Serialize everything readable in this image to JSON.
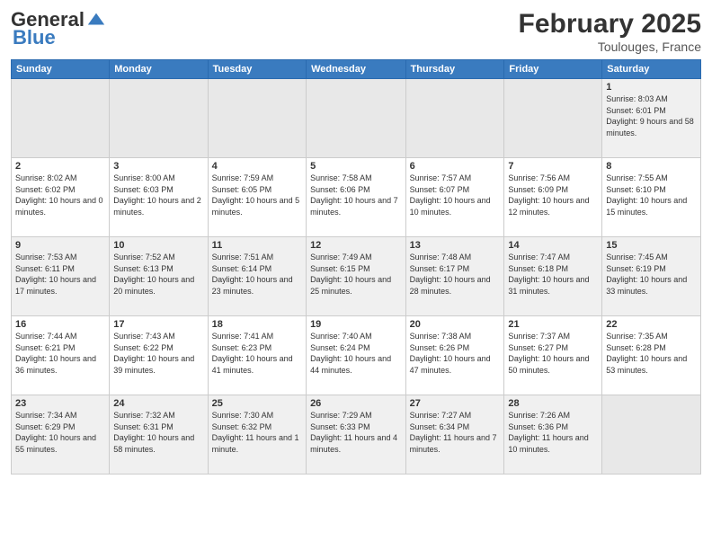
{
  "header": {
    "logo_general": "General",
    "logo_blue": "Blue",
    "month_title": "February 2025",
    "location": "Toulouges, France"
  },
  "weekdays": [
    "Sunday",
    "Monday",
    "Tuesday",
    "Wednesday",
    "Thursday",
    "Friday",
    "Saturday"
  ],
  "weeks": [
    [
      {
        "day": "",
        "info": ""
      },
      {
        "day": "",
        "info": ""
      },
      {
        "day": "",
        "info": ""
      },
      {
        "day": "",
        "info": ""
      },
      {
        "day": "",
        "info": ""
      },
      {
        "day": "",
        "info": ""
      },
      {
        "day": "1",
        "info": "Sunrise: 8:03 AM\nSunset: 6:01 PM\nDaylight: 9 hours and 58 minutes."
      }
    ],
    [
      {
        "day": "2",
        "info": "Sunrise: 8:02 AM\nSunset: 6:02 PM\nDaylight: 10 hours and 0 minutes."
      },
      {
        "day": "3",
        "info": "Sunrise: 8:00 AM\nSunset: 6:03 PM\nDaylight: 10 hours and 2 minutes."
      },
      {
        "day": "4",
        "info": "Sunrise: 7:59 AM\nSunset: 6:05 PM\nDaylight: 10 hours and 5 minutes."
      },
      {
        "day": "5",
        "info": "Sunrise: 7:58 AM\nSunset: 6:06 PM\nDaylight: 10 hours and 7 minutes."
      },
      {
        "day": "6",
        "info": "Sunrise: 7:57 AM\nSunset: 6:07 PM\nDaylight: 10 hours and 10 minutes."
      },
      {
        "day": "7",
        "info": "Sunrise: 7:56 AM\nSunset: 6:09 PM\nDaylight: 10 hours and 12 minutes."
      },
      {
        "day": "8",
        "info": "Sunrise: 7:55 AM\nSunset: 6:10 PM\nDaylight: 10 hours and 15 minutes."
      }
    ],
    [
      {
        "day": "9",
        "info": "Sunrise: 7:53 AM\nSunset: 6:11 PM\nDaylight: 10 hours and 17 minutes."
      },
      {
        "day": "10",
        "info": "Sunrise: 7:52 AM\nSunset: 6:13 PM\nDaylight: 10 hours and 20 minutes."
      },
      {
        "day": "11",
        "info": "Sunrise: 7:51 AM\nSunset: 6:14 PM\nDaylight: 10 hours and 23 minutes."
      },
      {
        "day": "12",
        "info": "Sunrise: 7:49 AM\nSunset: 6:15 PM\nDaylight: 10 hours and 25 minutes."
      },
      {
        "day": "13",
        "info": "Sunrise: 7:48 AM\nSunset: 6:17 PM\nDaylight: 10 hours and 28 minutes."
      },
      {
        "day": "14",
        "info": "Sunrise: 7:47 AM\nSunset: 6:18 PM\nDaylight: 10 hours and 31 minutes."
      },
      {
        "day": "15",
        "info": "Sunrise: 7:45 AM\nSunset: 6:19 PM\nDaylight: 10 hours and 33 minutes."
      }
    ],
    [
      {
        "day": "16",
        "info": "Sunrise: 7:44 AM\nSunset: 6:21 PM\nDaylight: 10 hours and 36 minutes."
      },
      {
        "day": "17",
        "info": "Sunrise: 7:43 AM\nSunset: 6:22 PM\nDaylight: 10 hours and 39 minutes."
      },
      {
        "day": "18",
        "info": "Sunrise: 7:41 AM\nSunset: 6:23 PM\nDaylight: 10 hours and 41 minutes."
      },
      {
        "day": "19",
        "info": "Sunrise: 7:40 AM\nSunset: 6:24 PM\nDaylight: 10 hours and 44 minutes."
      },
      {
        "day": "20",
        "info": "Sunrise: 7:38 AM\nSunset: 6:26 PM\nDaylight: 10 hours and 47 minutes."
      },
      {
        "day": "21",
        "info": "Sunrise: 7:37 AM\nSunset: 6:27 PM\nDaylight: 10 hours and 50 minutes."
      },
      {
        "day": "22",
        "info": "Sunrise: 7:35 AM\nSunset: 6:28 PM\nDaylight: 10 hours and 53 minutes."
      }
    ],
    [
      {
        "day": "23",
        "info": "Sunrise: 7:34 AM\nSunset: 6:29 PM\nDaylight: 10 hours and 55 minutes."
      },
      {
        "day": "24",
        "info": "Sunrise: 7:32 AM\nSunset: 6:31 PM\nDaylight: 10 hours and 58 minutes."
      },
      {
        "day": "25",
        "info": "Sunrise: 7:30 AM\nSunset: 6:32 PM\nDaylight: 11 hours and 1 minute."
      },
      {
        "day": "26",
        "info": "Sunrise: 7:29 AM\nSunset: 6:33 PM\nDaylight: 11 hours and 4 minutes."
      },
      {
        "day": "27",
        "info": "Sunrise: 7:27 AM\nSunset: 6:34 PM\nDaylight: 11 hours and 7 minutes."
      },
      {
        "day": "28",
        "info": "Sunrise: 7:26 AM\nSunset: 6:36 PM\nDaylight: 11 hours and 10 minutes."
      },
      {
        "day": "",
        "info": ""
      }
    ]
  ]
}
